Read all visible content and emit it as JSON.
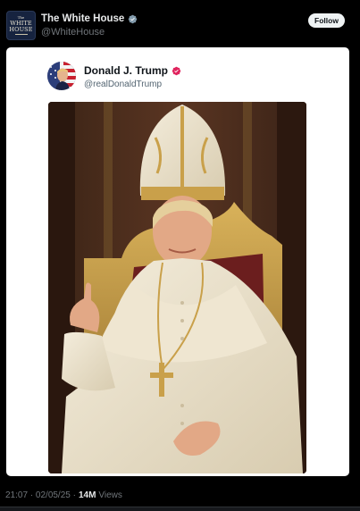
{
  "post": {
    "author": {
      "display_name": "The White House",
      "handle": "@WhiteHouse",
      "verified": true,
      "avatar_icon": "white-house-logo",
      "avatar_lines": [
        "The",
        "WHITE",
        "HOUSE"
      ]
    },
    "follow_label": "Follow",
    "timestamp": "21:07 · 02/05/25 ·",
    "views_count": "14M",
    "views_label": "Views"
  },
  "embedded": {
    "display_name": "Donald J. Trump",
    "handle": "@realDonaldTrump",
    "verified_color": "#e0245e",
    "avatar_icon": "american-flag-portrait",
    "image_icon": "man-in-papal-vestments-on-throne"
  },
  "colors": {
    "background": "#000000",
    "card": "#ffffff",
    "verified_blue": "#1d9bf0",
    "muted": "#71767b"
  }
}
